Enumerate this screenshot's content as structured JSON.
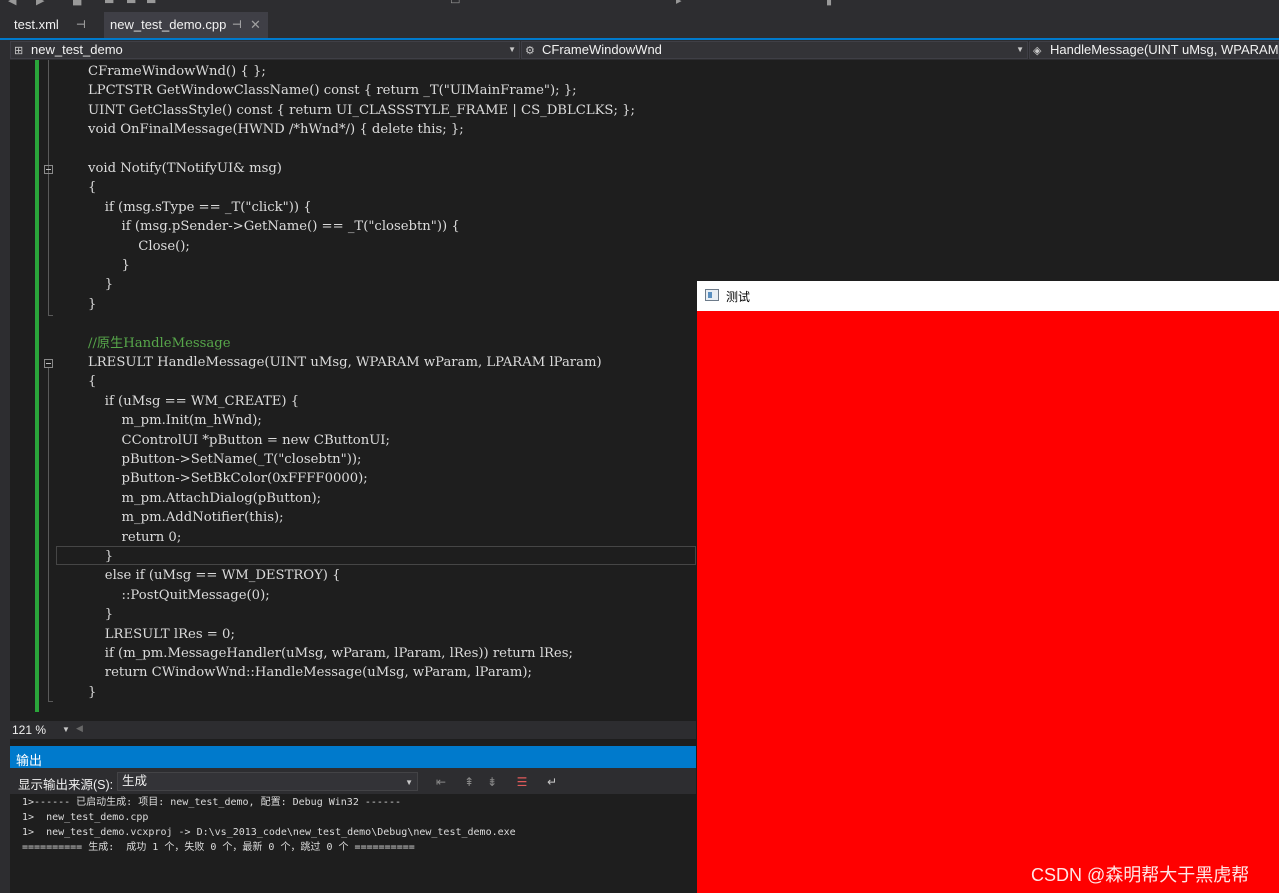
{
  "tabs": [
    {
      "label": "test.xml",
      "pinned": true
    },
    {
      "label": "new_test_demo.cpp",
      "pinned": true,
      "active": true
    }
  ],
  "nav": {
    "project": "new_test_demo",
    "class": "CFrameWindowWnd",
    "member": "HandleMessage(UINT uMsg, WPARAM"
  },
  "code_lines": [
    "CFrameWindowWnd() { };",
    "LPCTSTR GetWindowClassName() const { return _T(\"UIMainFrame\"); };",
    "UINT GetClassStyle() const { return UI_CLASSSTYLE_FRAME | CS_DBLCLKS; };",
    "void OnFinalMessage(HWND /*hWnd*/) { delete this; };",
    "",
    "void Notify(TNotifyUI& msg)",
    "{",
    "    if (msg.sType == _T(\"click\")) {",
    "        if (msg.pSender->GetName() == _T(\"closebtn\")) {",
    "            Close();",
    "        }",
    "    }",
    "}",
    "",
    "//原生HandleMessage",
    "LRESULT HandleMessage(UINT uMsg, WPARAM wParam, LPARAM lParam)",
    "{",
    "    if (uMsg == WM_CREATE) {",
    "        m_pm.Init(m_hWnd);",
    "        CControlUI *pButton = new CButtonUI;",
    "        pButton->SetName(_T(\"closebtn\"));",
    "        pButton->SetBkColor(0xFFFF0000);",
    "        m_pm.AttachDialog(pButton);",
    "        m_pm.AddNotifier(this);",
    "        return 0;",
    "    }",
    "    else if (uMsg == WM_DESTROY) {",
    "        ::PostQuitMessage(0);",
    "    }",
    "    LRESULT lRes = 0;",
    "    if (m_pm.MessageHandler(uMsg, wParam, lParam, lRes)) return lRes;",
    "    return CWindowWnd::HandleMessage(uMsg, wParam, lParam);",
    "}"
  ],
  "zoom": "121 %",
  "output": {
    "title": "输出",
    "source_label": "显示输出来源(S):",
    "source_value": "生成",
    "lines": [
      "1>------ 已启动生成: 项目: new_test_demo, 配置: Debug Win32 ------",
      "1>  new_test_demo.cpp",
      "1>  new_test_demo.vcxproj -> D:\\vs_2013_code\\new_test_demo\\Debug\\new_test_demo.exe",
      "========== 生成:  成功 1 个，失败 0 个，最新 0 个，跳过 0 个 =========="
    ]
  },
  "app_window": {
    "title": "测试",
    "background": "#ff0000"
  },
  "watermark": "CSDN @森明帮大于黑虎帮",
  "colors": {
    "accent": "#007acc",
    "editor_bg": "#1e1e1e",
    "change_bar": "#2aa53a"
  }
}
